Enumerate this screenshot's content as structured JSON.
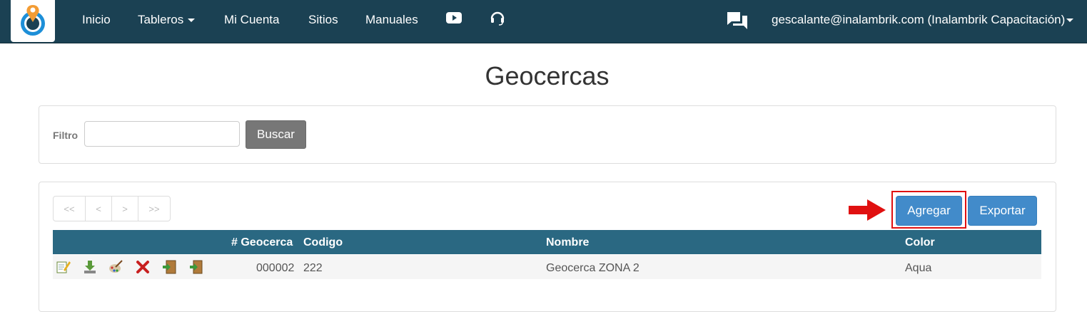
{
  "navbar": {
    "logo_icon": "map-pin-power-icon",
    "links": {
      "inicio": "Inicio",
      "tableros": "Tableros",
      "mi_cuenta": "Mi Cuenta",
      "sitios": "Sitios",
      "manuales": "Manuales"
    },
    "youtube_icon": "youtube-icon",
    "support_icon": "headset-icon",
    "chat_icon": "chat-icon",
    "user": "gescalante@inalambrik.com (Inalambrik Capacitación)"
  },
  "page": {
    "title": "Geocercas"
  },
  "filter": {
    "label": "Filtro",
    "value": "",
    "search_button": "Buscar"
  },
  "pager": {
    "first": "<<",
    "prev": "<",
    "next": ">",
    "last": ">>"
  },
  "actions": {
    "add": "Agregar",
    "export": "Exportar"
  },
  "table": {
    "columns": {
      "geocerca": "# Geocerca",
      "codigo": "Codigo",
      "nombre": "Nombre",
      "color": "Color"
    },
    "rows": [
      {
        "icons": [
          "edit-icon",
          "download-icon",
          "palette-icon",
          "delete-icon",
          "exit-door-icon",
          "enter-door-icon"
        ],
        "geocerca": "000002",
        "codigo": "222",
        "nombre": "Geocerca ZONA 2",
        "color": "Aqua"
      }
    ]
  },
  "colors": {
    "navbar": "#1b4153",
    "table_header": "#2a6882",
    "primary": "#428bca",
    "search_button": "#777777",
    "highlight": "#e01010"
  }
}
